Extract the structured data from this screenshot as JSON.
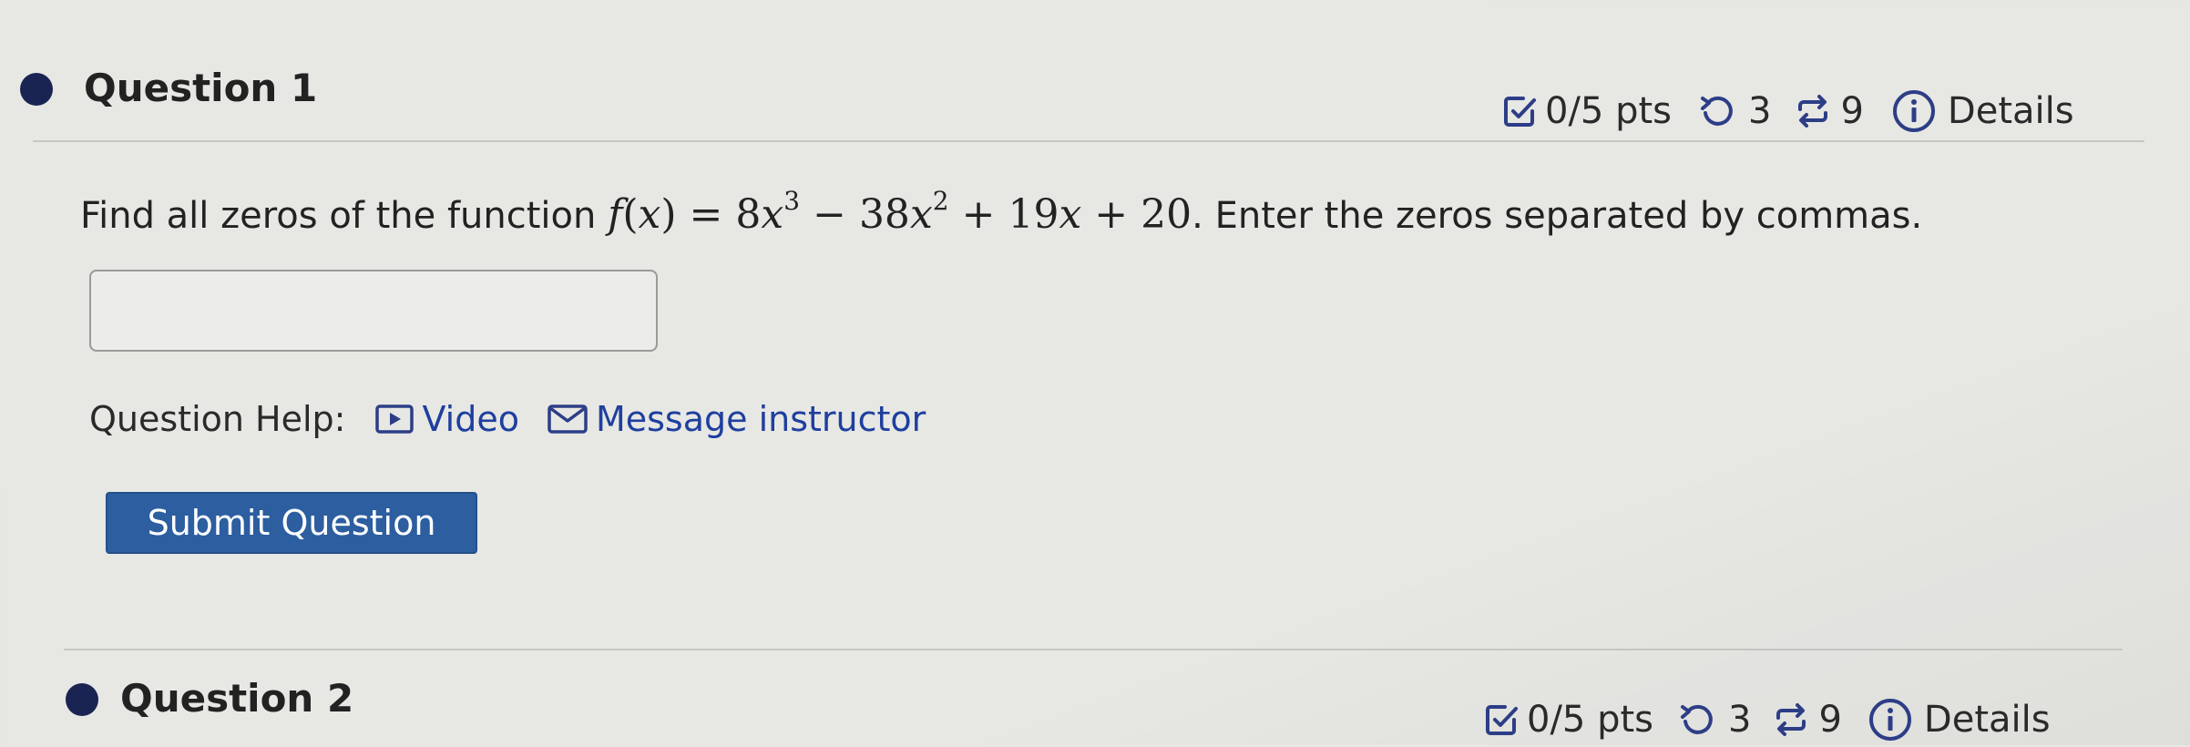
{
  "question1": {
    "title": "Question 1",
    "points": "0/5 pts",
    "attempts": "3",
    "versions": "9",
    "details_label": "Details",
    "prompt_before": "Find all zeros of the function",
    "prompt_after": ". Enter the zeros separated by commas.",
    "function": {
      "name": "f",
      "variable": "x",
      "equals": "=",
      "c3": "8",
      "exp3": "3",
      "op1": "−",
      "c2": "38",
      "exp2": "2",
      "op2": "+",
      "c1": "19",
      "op3": "+",
      "c0": "20"
    },
    "answer_value": "",
    "help_label": "Question Help:",
    "video_label": "Video",
    "message_label": "Message instructor",
    "submit_label": "Submit Question"
  },
  "question2": {
    "title": "Question 2",
    "points": "0/5 pts",
    "attempts": "3",
    "versions": "9",
    "details_label": "Details"
  },
  "colors": {
    "accent_dark_blue": "#1a2452",
    "link_blue": "#1e3f9e",
    "submit_button": "#2c5ea0"
  },
  "icons": {
    "points": "checkbox-icon",
    "attempts": "retry-icon",
    "versions": "shuffle-icon",
    "details": "info-icon",
    "video": "video-play-icon",
    "message": "envelope-icon"
  }
}
